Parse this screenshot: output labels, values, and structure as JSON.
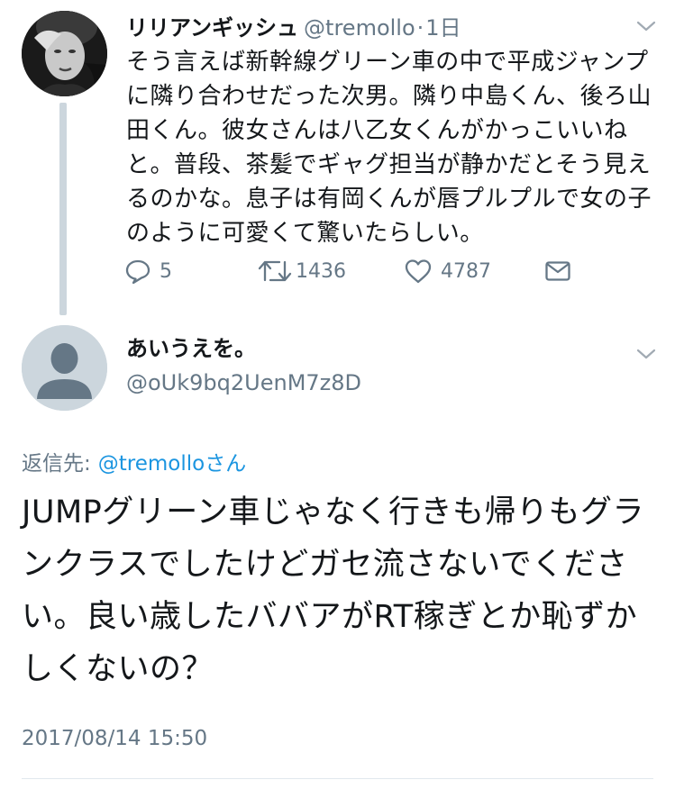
{
  "original_tweet": {
    "display_name": "リリアンギッシュ",
    "handle": "@tremollo",
    "separator": "·",
    "time": "1日",
    "text": "そう言えば新幹線グリーン車の中で平成ジャンプに隣り合わせだった次男。隣り中島くん、後ろ山田くん。彼女さんは八乙女くんがかっこいいねと。普段、茶髪でギャグ担当が静かだとそう見えるのかな。息子は有岡くんが唇プルプルで女の子のように可愛くて驚いたらしい。",
    "actions": {
      "reply_count": "5",
      "retweet_count": "1436",
      "like_count": "4787"
    }
  },
  "reply_tweet": {
    "display_name": "あいうえを。",
    "handle": "@oUk9bq2UenM7z8D",
    "reply_to_prefix": "返信先:",
    "reply_to_target": "@tremolloさん",
    "text": "JUMPグリーン車じゃなく行きも帰りもグランクラスでしたけどガセ流さないでください。良い歳したババアがRT稼ぎとか恥ずかしくないの？",
    "timestamp": "2017/08/14 15:50"
  },
  "colors": {
    "text_primary": "#14171a",
    "text_secondary": "#657786",
    "link_blue": "#1b95e0",
    "thread_line": "#ccd6dd",
    "divider": "#e1e8ed"
  },
  "icons": [
    "chevron-down-icon",
    "reply-icon",
    "retweet-icon",
    "like-icon",
    "direct-message-icon",
    "default-avatar-icon"
  ]
}
